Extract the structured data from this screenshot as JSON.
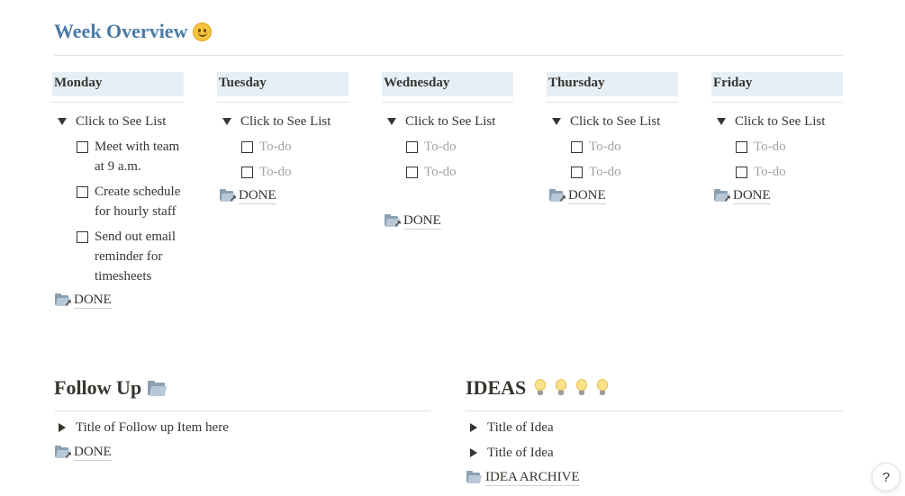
{
  "page": {
    "title": "Week Overview",
    "title_color": "#4a7aa6"
  },
  "days": [
    {
      "name": "Monday",
      "toggle": "Click to See List",
      "todos": [
        {
          "text": "Meet with team at 9 a.m.",
          "placeholder": false
        },
        {
          "text": "Create schedule for hourly staff",
          "placeholder": false
        },
        {
          "text": "Send out email reminder for timesheets",
          "placeholder": false
        }
      ],
      "done": "DONE"
    },
    {
      "name": "Tuesday",
      "toggle": "Click to See List",
      "todos": [
        {
          "text": "To-do",
          "placeholder": true
        },
        {
          "text": "To-do",
          "placeholder": true
        }
      ],
      "done": "DONE"
    },
    {
      "name": "Wednesday",
      "toggle": "Click to See List",
      "todos": [
        {
          "text": "To-do",
          "placeholder": true
        },
        {
          "text": "To-do",
          "placeholder": true
        }
      ],
      "done": "DONE"
    },
    {
      "name": "Thursday",
      "toggle": "Click to See List",
      "todos": [
        {
          "text": "To-do",
          "placeholder": true
        },
        {
          "text": "To-do",
          "placeholder": true
        }
      ],
      "done": "DONE"
    },
    {
      "name": "Friday",
      "toggle": "Click to See List",
      "todos": [
        {
          "text": "To-do",
          "placeholder": true
        },
        {
          "text": "To-do",
          "placeholder": true
        }
      ],
      "done": "DONE"
    }
  ],
  "follow_up": {
    "title": "Follow Up",
    "items": [
      "Title of Follow up Item here"
    ],
    "done": "DONE"
  },
  "ideas": {
    "title": "IDEAS",
    "items": [
      "Title of Idea",
      "Title of Idea"
    ],
    "archive": "IDEA ARCHIVE"
  },
  "help": {
    "label": "?"
  }
}
